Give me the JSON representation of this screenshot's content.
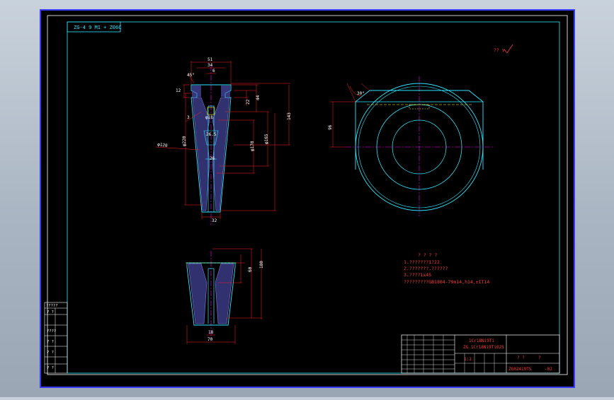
{
  "viewport": {
    "background": "#000000",
    "frame_color": "#3a3aff"
  },
  "colors": {
    "part_outline": "#2ee6ff",
    "hatch": "#8a8aff",
    "dimension": "#ff2020",
    "centerline": "#ff00ff",
    "hidden": "#ffff40",
    "text": "#ffffff",
    "annotation": "#ff3b3b"
  },
  "drawing_code_box": "ZG-4 9 M1 + Z06C",
  "roughness_mark": "?? ∨",
  "section_view": {
    "dims": {
      "top_width": "51",
      "top_inner": "34",
      "top_slot": "6",
      "left_top": "12",
      "chamfer": "45°",
      "d1": "22",
      "d2": "44",
      "mid": "26.5",
      "mid2": "26",
      "length": "143",
      "phi_170": "φ170",
      "phi_165": "φ165",
      "phi_220": "φ220",
      "phi_120": "φ120",
      "left_small": "3",
      "bottom": "32",
      "phi_18": "φ18"
    }
  },
  "bottom_view": {
    "dims": {
      "height": "60",
      "total": "180",
      "width": "70",
      "slot": "18"
    }
  },
  "top_view": {
    "dims": {
      "angle": "30°",
      "height": "96"
    }
  },
  "notes": {
    "title": "? ? ? ?",
    "lines": [
      "1.???????1?22",
      "2.???????.??????",
      "3.????1x45",
      "  ?????????GB1804-79m14,h14,±IT14"
    ]
  },
  "left_table": {
    "rows": [
      "?????",
      "? ?",
      "????",
      "? ?",
      "? ?",
      "? ?"
    ]
  },
  "title_block": {
    "spec_line1": "1Cr18Ni9Ti",
    "spec_line2": "ZG 1Cr18Ni9Ti025",
    "name": "? ?",
    "name2": "?",
    "drawing_number": "ZG02419TS",
    "suffix": "-02",
    "scale_label": "1:1"
  }
}
